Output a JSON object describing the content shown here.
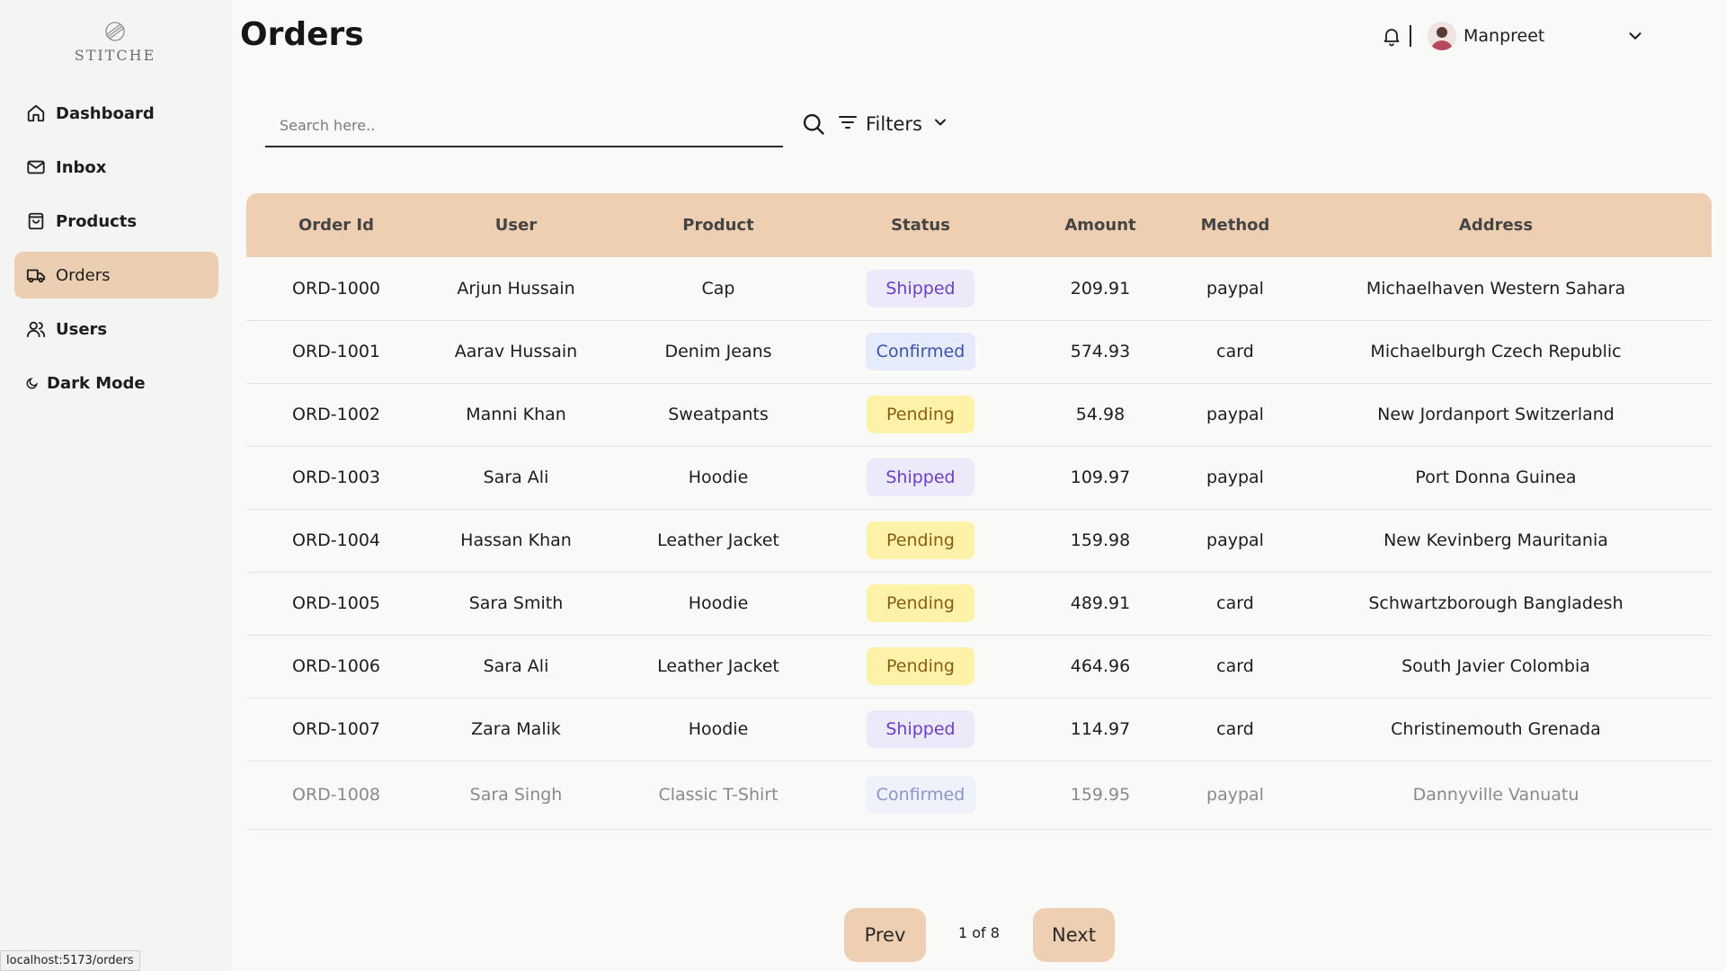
{
  "brand": {
    "name": "STITCHE"
  },
  "sidebar": {
    "items": [
      {
        "label": "Dashboard",
        "icon": "home-icon",
        "active": false
      },
      {
        "label": "Inbox",
        "icon": "mail-icon",
        "active": false
      },
      {
        "label": "Products",
        "icon": "shopping-bag-icon",
        "active": false
      },
      {
        "label": "Orders",
        "icon": "truck-icon",
        "active": true
      },
      {
        "label": "Users",
        "icon": "users-icon",
        "active": false
      },
      {
        "label": "Dark Mode",
        "icon": "moon-icon",
        "active": false
      }
    ]
  },
  "header": {
    "title": "Orders",
    "user_name": "Manpreet"
  },
  "search": {
    "placeholder": "Search here..",
    "value": ""
  },
  "filters": {
    "label": "Filters"
  },
  "table": {
    "columns": [
      "Order Id",
      "User",
      "Product",
      "Status",
      "Amount",
      "Method",
      "Address"
    ],
    "rows": [
      {
        "id": "ORD-1000",
        "user": "Arjun Hussain",
        "product": "Cap",
        "status": "Shipped",
        "amount": "209.91",
        "method": "paypal",
        "address": "Michaelhaven Western Sahara"
      },
      {
        "id": "ORD-1001",
        "user": "Aarav Hussain",
        "product": "Denim Jeans",
        "status": "Confirmed",
        "amount": "574.93",
        "method": "card",
        "address": "Michaelburgh Czech Republic"
      },
      {
        "id": "ORD-1002",
        "user": "Manni Khan",
        "product": "Sweatpants",
        "status": "Pending",
        "amount": "54.98",
        "method": "paypal",
        "address": "New Jordanport Switzerland"
      },
      {
        "id": "ORD-1003",
        "user": "Sara Ali",
        "product": "Hoodie",
        "status": "Shipped",
        "amount": "109.97",
        "method": "paypal",
        "address": "Port Donna Guinea"
      },
      {
        "id": "ORD-1004",
        "user": "Hassan Khan",
        "product": "Leather Jacket",
        "status": "Pending",
        "amount": "159.98",
        "method": "paypal",
        "address": "New Kevinberg Mauritania"
      },
      {
        "id": "ORD-1005",
        "user": "Sara Smith",
        "product": "Hoodie",
        "status": "Pending",
        "amount": "489.91",
        "method": "card",
        "address": "Schwartzborough Bangladesh"
      },
      {
        "id": "ORD-1006",
        "user": "Sara Ali",
        "product": "Leather Jacket",
        "status": "Pending",
        "amount": "464.96",
        "method": "card",
        "address": "South Javier Colombia"
      },
      {
        "id": "ORD-1007",
        "user": "Zara Malik",
        "product": "Hoodie",
        "status": "Shipped",
        "amount": "114.97",
        "method": "card",
        "address": "Christinemouth Grenada"
      },
      {
        "id": "ORD-1008",
        "user": "Sara Singh",
        "product": "Classic T-Shirt",
        "status": "Confirmed",
        "amount": "159.95",
        "method": "paypal",
        "address": "Dannyville Vanuatu"
      }
    ]
  },
  "pagination": {
    "prev_label": "Prev",
    "next_label": "Next",
    "info": "1 of 8"
  },
  "status_bar": {
    "url": "localhost:5173/orders"
  },
  "colors": {
    "accent": "#eecfb1",
    "shipped": "#6b3fc8",
    "confirmed": "#3c52a8",
    "pending": "#fdf2a8"
  }
}
